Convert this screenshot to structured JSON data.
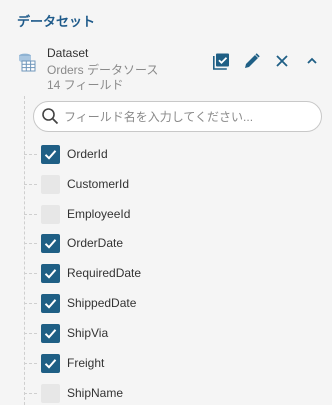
{
  "section": {
    "title": "データセット"
  },
  "dataset": {
    "name": "Dataset",
    "source": "Orders データソース",
    "field_count": "14 フィールド",
    "icon": "database-table-icon"
  },
  "toolbar": {
    "select_all_icon": "checklist-icon",
    "edit_icon": "pencil-icon",
    "remove_icon": "close-icon",
    "collapse_icon": "chevron-up-icon"
  },
  "search": {
    "placeholder": "フィールド名を入力してください...",
    "value": ""
  },
  "fields": [
    {
      "name": "OrderId",
      "checked": true
    },
    {
      "name": "CustomerId",
      "checked": false
    },
    {
      "name": "EmployeeId",
      "checked": false
    },
    {
      "name": "OrderDate",
      "checked": true
    },
    {
      "name": "RequiredDate",
      "checked": true
    },
    {
      "name": "ShippedDate",
      "checked": true
    },
    {
      "name": "ShipVia",
      "checked": true
    },
    {
      "name": "Freight",
      "checked": true
    },
    {
      "name": "ShipName",
      "checked": false
    }
  ],
  "colors": {
    "accent": "#1f5f85",
    "title": "#1e5a8a",
    "icon": "#1f5f85"
  }
}
